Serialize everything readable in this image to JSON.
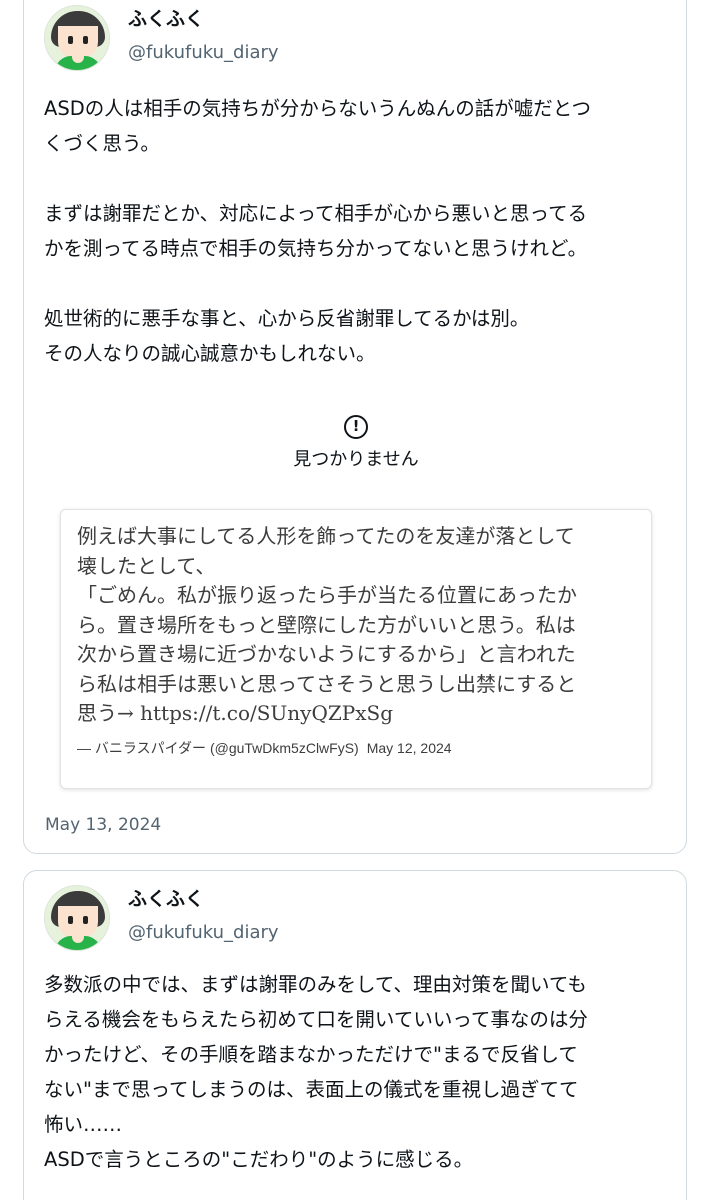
{
  "tweets": [
    {
      "author": {
        "name": "ふくふく",
        "handle": "@fukufuku_diary"
      },
      "paragraphs": [
        [
          "ASDの人は相手の気持ちが分からないうんぬんの話が嘘だとつ",
          "くづく思う。"
        ],
        [
          "まずは謝罪だとか、対応によって相手が心から悪いと思ってる",
          "かを測ってる時点で相手の気持ち分かってないと思うけれど。"
        ],
        [
          "処世術的に悪手な事と、心から反省謝罪してるかは別。",
          "その人なりの誠心誠意かもしれない。"
        ]
      ],
      "not_found": {
        "icon": "alert-circle-icon",
        "text": "見つかりません"
      },
      "quote": {
        "lines": [
          "例えば大事にしてる人形を飾ってたのを友達が落として",
          "壊したとして、",
          "「ごめん。私が振り返ったら手が当たる位置にあったか",
          "ら。置き場所をもっと壁際にした方がいいと思う。私は",
          "次から置き場に近づかないようにするから」と言われた",
          "ら私は相手は悪いと思ってさそうと思うし出禁にすると",
          "思う→ https://t.co/SUnyQZPxSg"
        ],
        "attribution": "— バニラスパイダー (@guTwDkm5zClwFyS)",
        "date": "May 12, 2024"
      },
      "timestamp": "May 13, 2024"
    },
    {
      "author": {
        "name": "ふくふく",
        "handle": "@fukufuku_diary"
      },
      "lines": [
        "多数派の中では、まずは謝罪のみをして、理由対策を聞いても",
        "らえる機会をもらえたら初めて口を開いていいって事なのは分",
        "かったけど、その手順を踏まなかっただけで\"まるで反省して",
        "ない\"まで思ってしまうのは、表面上の儀式を重視し過ぎてて",
        "怖い……",
        "ASDで言うところの\"こだわり\"のように感じる。"
      ]
    }
  ]
}
